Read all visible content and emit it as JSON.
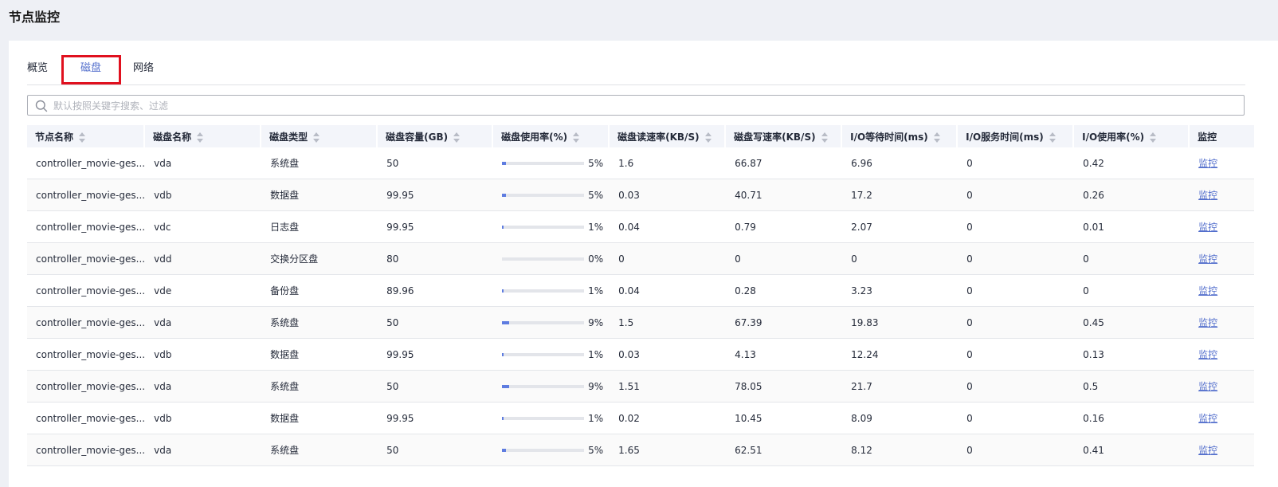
{
  "page": {
    "title": "节点监控"
  },
  "tabs": [
    {
      "label": "概览",
      "active": false
    },
    {
      "label": "磁盘",
      "active": true
    },
    {
      "label": "网络",
      "active": false
    }
  ],
  "search": {
    "placeholder": "默认按照关键字搜索、过滤",
    "value": ""
  },
  "table": {
    "columns": [
      "节点名称",
      "磁盘名称",
      "磁盘类型",
      "磁盘容量(GB)",
      "磁盘使用率(%)",
      "磁盘读速率(KB/S)",
      "磁盘写速率(KB/S)",
      "I/O等待时间(ms)",
      "I/O服务时间(ms)",
      "I/O使用率(%)",
      "监控"
    ],
    "rows": [
      {
        "node": "controller_movie-ges...",
        "disk": "vda",
        "type": "系统盘",
        "capacity": "50",
        "usage": 5,
        "usage_label": "5%",
        "read": "1.6",
        "write": "66.87",
        "io_wait": "6.96",
        "io_service": "0",
        "io_usage": "0.42",
        "action": "监控"
      },
      {
        "node": "controller_movie-ges...",
        "disk": "vdb",
        "type": "数据盘",
        "capacity": "99.95",
        "usage": 5,
        "usage_label": "5%",
        "read": "0.03",
        "write": "40.71",
        "io_wait": "17.2",
        "io_service": "0",
        "io_usage": "0.26",
        "action": "监控"
      },
      {
        "node": "controller_movie-ges...",
        "disk": "vdc",
        "type": "日志盘",
        "capacity": "99.95",
        "usage": 1,
        "usage_label": "1%",
        "read": "0.04",
        "write": "0.79",
        "io_wait": "2.07",
        "io_service": "0",
        "io_usage": "0.01",
        "action": "监控"
      },
      {
        "node": "controller_movie-ges...",
        "disk": "vdd",
        "type": "交换分区盘",
        "capacity": "80",
        "usage": 0,
        "usage_label": "0%",
        "read": "0",
        "write": "0",
        "io_wait": "0",
        "io_service": "0",
        "io_usage": "0",
        "action": "监控"
      },
      {
        "node": "controller_movie-ges...",
        "disk": "vde",
        "type": "备份盘",
        "capacity": "89.96",
        "usage": 1,
        "usage_label": "1%",
        "read": "0.04",
        "write": "0.28",
        "io_wait": "3.23",
        "io_service": "0",
        "io_usage": "0",
        "action": "监控"
      },
      {
        "node": "controller_movie-ges...",
        "disk": "vda",
        "type": "系统盘",
        "capacity": "50",
        "usage": 9,
        "usage_label": "9%",
        "read": "1.5",
        "write": "67.39",
        "io_wait": "19.83",
        "io_service": "0",
        "io_usage": "0.45",
        "action": "监控"
      },
      {
        "node": "controller_movie-ges...",
        "disk": "vdb",
        "type": "数据盘",
        "capacity": "99.95",
        "usage": 1,
        "usage_label": "1%",
        "read": "0.03",
        "write": "4.13",
        "io_wait": "12.24",
        "io_service": "0",
        "io_usage": "0.13",
        "action": "监控"
      },
      {
        "node": "controller_movie-ges...",
        "disk": "vda",
        "type": "系统盘",
        "capacity": "50",
        "usage": 9,
        "usage_label": "9%",
        "read": "1.51",
        "write": "78.05",
        "io_wait": "21.7",
        "io_service": "0",
        "io_usage": "0.5",
        "action": "监控"
      },
      {
        "node": "controller_movie-ges...",
        "disk": "vdb",
        "type": "数据盘",
        "capacity": "99.95",
        "usage": 1,
        "usage_label": "1%",
        "read": "0.02",
        "write": "10.45",
        "io_wait": "8.09",
        "io_service": "0",
        "io_usage": "0.16",
        "action": "监控"
      },
      {
        "node": "controller_movie-ges...",
        "disk": "vda",
        "type": "系统盘",
        "capacity": "50",
        "usage": 5,
        "usage_label": "5%",
        "read": "1.65",
        "write": "62.51",
        "io_wait": "8.12",
        "io_service": "0",
        "io_usage": "0.41",
        "action": "监控"
      }
    ]
  },
  "colors": {
    "accent": "#526ecc",
    "bar_fill": "#5e7ce0",
    "highlight": "#e0101e"
  }
}
